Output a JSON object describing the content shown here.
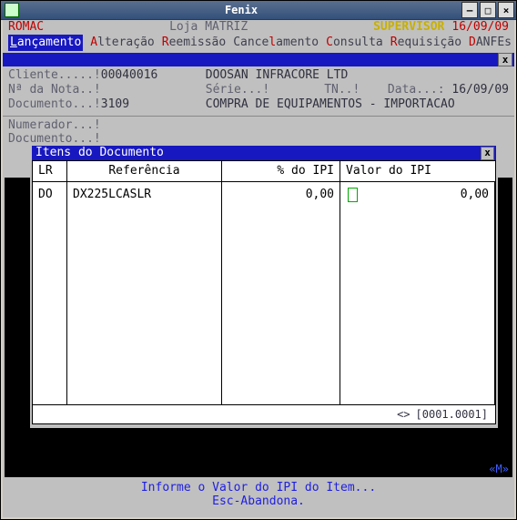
{
  "window": {
    "title": "Fenix"
  },
  "header": {
    "company": "ROMAC",
    "store": "Loja MATRIZ",
    "role": "SUPERVISOR",
    "date": "16/09/09"
  },
  "menu": {
    "items": [
      {
        "hot": "L",
        "rest": "ançamento",
        "selected": true
      },
      {
        "hot": "A",
        "rest": "lteração"
      },
      {
        "hot": "R",
        "rest": "eemissão"
      },
      {
        "hot": "",
        "rest": "Cance",
        "hot2": "l",
        "rest2": "amento"
      },
      {
        "hot": "C",
        "rest": "onsulta"
      },
      {
        "hot": "R",
        "rest": "equisição"
      },
      {
        "hot": "D",
        "rest": "ANFEs"
      }
    ]
  },
  "info": {
    "cliente_lab": "Cliente.....!",
    "cliente_val": "00040016",
    "cliente_desc": "DOOSAN INFRACORE LTD",
    "nota_lab": "Nª da Nota..!",
    "serie_lab": "Série...!",
    "tn_lab": "TN..!",
    "data_lab": "Data...:",
    "data_val": "16/09/09",
    "doc_lab": "Documento...!",
    "doc_val": "3109",
    "doc_desc": "COMPRA DE EQUIPAMENTOS - IMPORTACAO",
    "numerador_lab": "Numerador...!",
    "documento2_lab": "Documento...!"
  },
  "subtitle": "Itens do Documento",
  "table": {
    "headers": {
      "lr": "LR",
      "ref": "Referência",
      "ipi": "% do IPI",
      "val": "Valor do IPI"
    },
    "rows": [
      {
        "lr": "DO",
        "ref": "DX225LCASLR",
        "ipi": "0,00",
        "val": "0,00"
      }
    ],
    "footer_nav": "<>",
    "footer_pos": "[0001.0001]"
  },
  "marker": "«M»",
  "bottom": {
    "line1": "Informe o Valor do IPI do Item...",
    "line2": "Esc-Abandona."
  }
}
